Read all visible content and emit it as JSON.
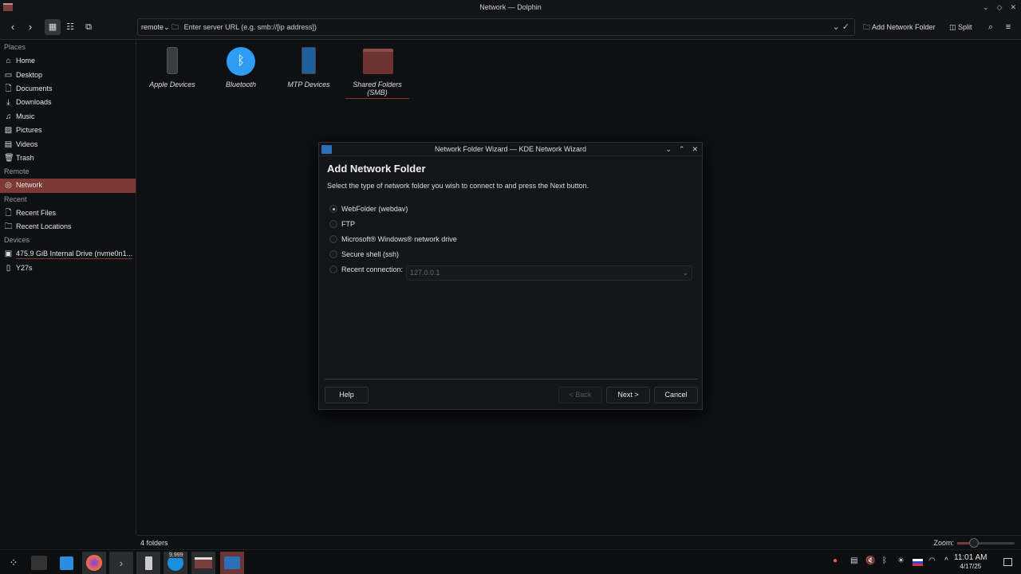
{
  "window": {
    "title": "Network — Dolphin"
  },
  "toolbar": {
    "location_mode": "remote",
    "url_placeholder": "Enter server URL (e.g. smb://[ip address])",
    "add_network_folder": "Add Network Folder",
    "split": "Split"
  },
  "sidebar": {
    "places_header": "Places",
    "places": [
      {
        "label": "Home",
        "icon": "home-icon"
      },
      {
        "label": "Desktop",
        "icon": "desktop-icon"
      },
      {
        "label": "Documents",
        "icon": "documents-icon"
      },
      {
        "label": "Downloads",
        "icon": "downloads-icon"
      },
      {
        "label": "Music",
        "icon": "music-icon"
      },
      {
        "label": "Pictures",
        "icon": "pictures-icon"
      },
      {
        "label": "Videos",
        "icon": "videos-icon"
      },
      {
        "label": "Trash",
        "icon": "trash-icon"
      }
    ],
    "remote_header": "Remote",
    "remote": [
      {
        "label": "Network",
        "icon": "network-icon"
      }
    ],
    "recent_header": "Recent",
    "recent": [
      {
        "label": "Recent Files"
      },
      {
        "label": "Recent Locations"
      }
    ],
    "devices_header": "Devices",
    "devices": [
      {
        "label": "475.9 GiB Internal Drive (nvme0n1..."
      },
      {
        "label": "Y27s"
      }
    ]
  },
  "files": [
    {
      "label": "Apple Devices"
    },
    {
      "label": "Bluetooth"
    },
    {
      "label": "MTP Devices"
    },
    {
      "label": "Shared Folders (SMB)"
    }
  ],
  "status": {
    "count": "4 folders",
    "zoom_label": "Zoom:",
    "zoom_level": 0.25
  },
  "dialog": {
    "title": "Network Folder Wizard — KDE Network Wizard",
    "heading": "Add Network Folder",
    "description": "Select the type of network folder you wish to connect to and press the Next button.",
    "options": [
      {
        "label": "WebFolder (webdav)",
        "selected": true
      },
      {
        "label": "FTP"
      },
      {
        "label": "Microsoft® Windows® network drive"
      },
      {
        "label": "Secure shell (ssh)"
      },
      {
        "label": "Recent connection:"
      }
    ],
    "recent_value": "127.0.0.1",
    "help": "Help",
    "back": "< Back",
    "next": "Next >",
    "cancel": "Cancel"
  },
  "taskbar": {
    "badge": "9,999",
    "time": "11:01 AM",
    "date": "4/17/25"
  },
  "colors": {
    "accent": "#7b3a36",
    "background": "#0f1013"
  }
}
